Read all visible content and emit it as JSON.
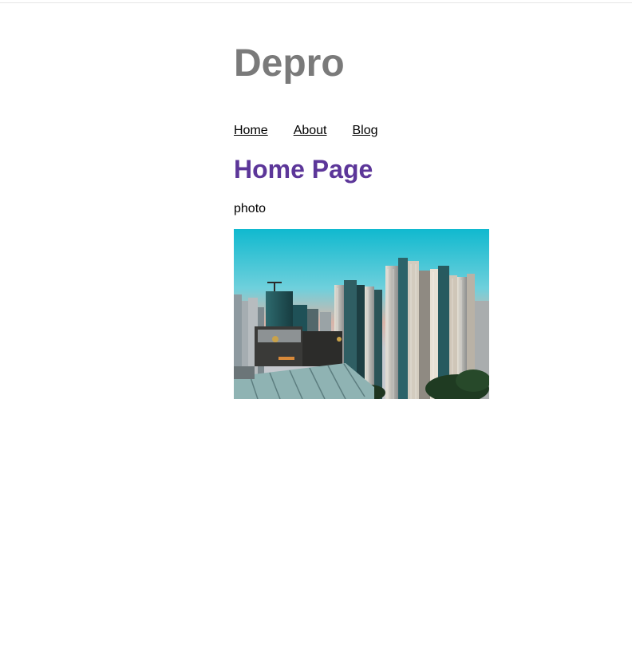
{
  "header": {
    "site_title": "Depro"
  },
  "nav": {
    "items": [
      {
        "label": "Home"
      },
      {
        "label": "About"
      },
      {
        "label": "Blog"
      }
    ]
  },
  "main": {
    "heading": "Home Page",
    "caption": "photo",
    "image_alt": "city skyline photo",
    "image_icon": "cityscape-photo"
  },
  "colors": {
    "site_title": "#7a7a7a",
    "heading": "#5c3699",
    "link": "#000000"
  }
}
